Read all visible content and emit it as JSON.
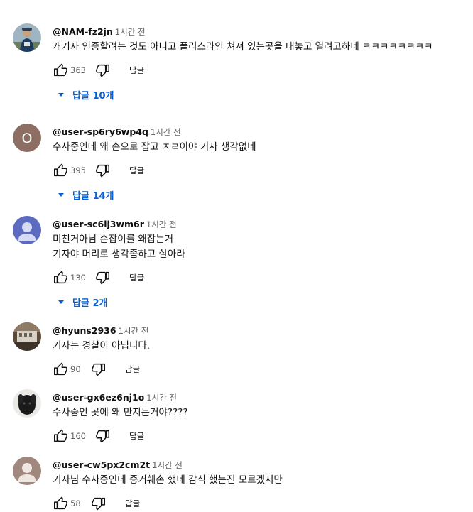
{
  "reply_label": "답글",
  "comments": [
    {
      "author": "@NAM-fz2jn",
      "time": "1시간 전",
      "lines": [
        "개기자 인증할려는 것도 아니고 폴리스라인 쳐져 있는곳을 대놓고 열려고하네 ㅋㅋㅋㅋㅋㅋㅋㅋ"
      ],
      "likes": "363",
      "replies": "답글 10개",
      "avatar": {
        "kind": "photo-person",
        "bg": "#8ea6b8"
      }
    },
    {
      "author": "@user-sp6ry6wp4q",
      "time": "1시간 전",
      "lines": [
        "수사중인데 왜 손으로 잡고 ㅈㄹ이야 기자 생각없네"
      ],
      "likes": "395",
      "replies": "답글 14개",
      "avatar": {
        "kind": "letter",
        "letter": "O",
        "bg": "#8d6e63"
      }
    },
    {
      "author": "@user-sc6lj3wm6r",
      "time": "1시간 전",
      "lines": [
        "미친거아님 손잡이를 왜잡는거",
        "기자야 머리로 생각좀하고 살아라"
      ],
      "likes": "130",
      "replies": "답글 2개",
      "avatar": {
        "kind": "default-person",
        "bg": "#5c6bc0"
      }
    },
    {
      "author": "@hyuns2936",
      "time": "1시간 전",
      "lines": [
        "기자는 경찰이 아닙니다."
      ],
      "likes": "90",
      "replies": "",
      "avatar": {
        "kind": "photo-building",
        "bg": "#6d5a48"
      }
    },
    {
      "author": "@user-gx6ez6nj1o",
      "time": "1시간 전",
      "lines": [
        "수사중인 곳에 왜 만지는거야????"
      ],
      "likes": "160",
      "replies": "",
      "avatar": {
        "kind": "photo-dog",
        "bg": "#e8e6e3"
      }
    },
    {
      "author": "@user-cw5px2cm2t",
      "time": "1시간 전",
      "lines": [
        "기자님 수사중인데 증거훼손 했네 감식 했는진 모르겠지만"
      ],
      "likes": "58",
      "replies": "",
      "avatar": {
        "kind": "default-person",
        "bg": "#a1887f"
      }
    }
  ]
}
